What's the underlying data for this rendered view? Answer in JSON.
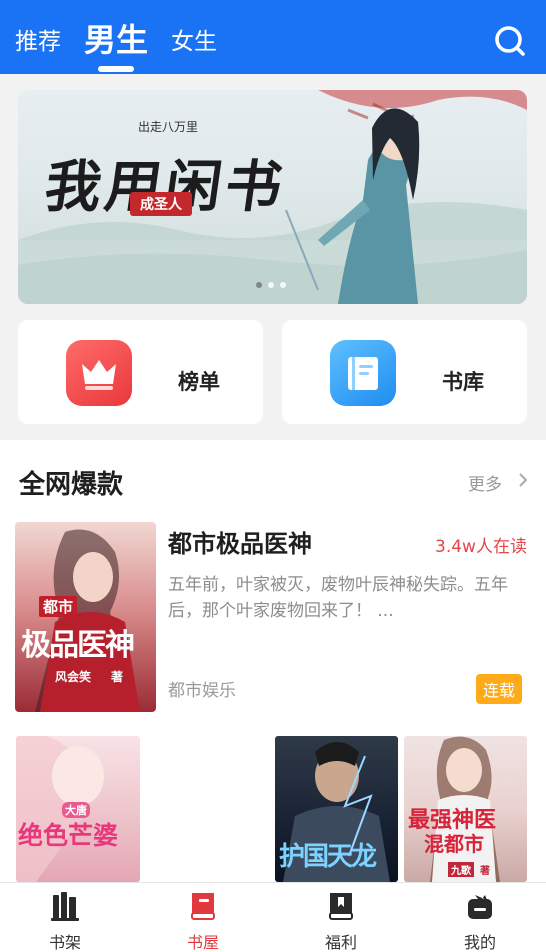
{
  "header": {
    "tabs": [
      {
        "label": "推荐",
        "active": false
      },
      {
        "label": "男生",
        "active": true
      },
      {
        "label": "女生",
        "active": false
      }
    ],
    "search_icon": "search-icon",
    "background": "#1a73f5"
  },
  "banner": {
    "author": "出走八万里",
    "title": "我用闲书",
    "subtitle": "成圣人",
    "dots": 3,
    "active_dot": 0
  },
  "entries": [
    {
      "label": "榜单",
      "icon": "crown-icon",
      "color": "#e9383a"
    },
    {
      "label": "书库",
      "icon": "book-icon",
      "color": "#1f8cf0"
    }
  ],
  "hot_section": {
    "title": "全网爆款",
    "more_label": "更多",
    "featured": {
      "title": "都市极品医神",
      "readers": "3.4w人在读",
      "description": "五年前，叶家被灭，废物叶辰神秘失踪。五年后，那个叶家废物回来了！ ...",
      "genre": "都市娱乐",
      "status": "连载",
      "cover_lines": [
        "都市",
        "极品医神",
        "风会笑",
        "著"
      ]
    },
    "covers": [
      {
        "lines": [
          "大唐",
          "绝色芒婆"
        ]
      },
      {
        "lines": [
          "护国天龙"
        ]
      },
      {
        "lines": [
          "最强神医",
          "混都市",
          "九歌",
          "著"
        ]
      }
    ]
  },
  "bottom_nav": [
    {
      "label": "书架",
      "icon": "bookshelf-icon",
      "active": false
    },
    {
      "label": "书屋",
      "icon": "bookstore-icon",
      "active": true
    },
    {
      "label": "福利",
      "icon": "gift-book-icon",
      "active": false
    },
    {
      "label": "我的",
      "icon": "profile-icon",
      "active": false
    }
  ],
  "accent_color": "#e03a3e"
}
